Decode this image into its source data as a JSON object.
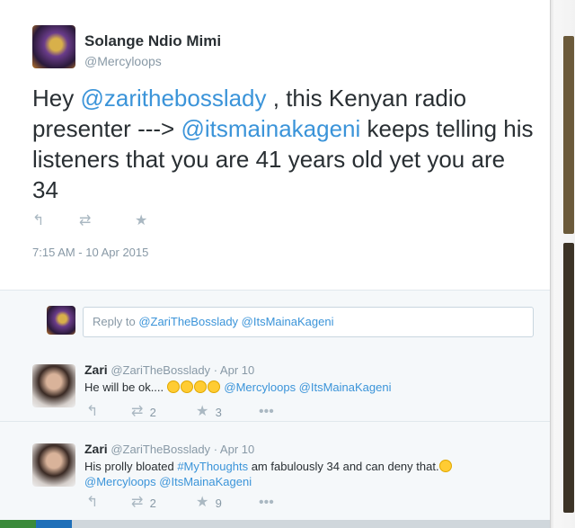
{
  "tweet": {
    "author_name": "Solange Ndio Mimi",
    "author_handle": "@Mercyloops",
    "text_parts": {
      "p1": "Hey ",
      "mention1": "@zarithebosslady",
      "p2": " , this Kenyan radio presenter ---> ",
      "mention2": "@itsmainakageni",
      "p3": " keeps telling his listeners that you are 41 years old yet you are 34"
    },
    "timestamp": "7:15 AM - 10 Apr 2015",
    "icons": [
      "reply-icon",
      "retweet-icon",
      "favorite-icon"
    ]
  },
  "reply_composer": {
    "placeholder_prefix": "Reply to ",
    "placeholder_mentions": "@ZariTheBosslady @ItsMainaKageni"
  },
  "replies": [
    {
      "name": "Zari",
      "handle": "@ZariTheBosslady",
      "date": "Apr 10",
      "text": "He will be ok....",
      "emoji_count": 4,
      "mentions": "@Mercyloops @ItsMainaKageni",
      "retweets": "2",
      "favorites": "3"
    },
    {
      "name": "Zari",
      "handle": "@ZariTheBosslady",
      "date": "Apr 10",
      "text_a": "His prolly bloated ",
      "hashtag": "#MyThoughts",
      "text_b": " am fabulously 34 and can deny that.",
      "mentions": "@Mercyloops @ItsMainaKageni",
      "retweets": "2",
      "favorites": "9"
    }
  ],
  "colors": {
    "link": "#3b94d9",
    "text": "#292f33",
    "muted": "#8899a6",
    "reply_bg": "#f5f8fa"
  }
}
